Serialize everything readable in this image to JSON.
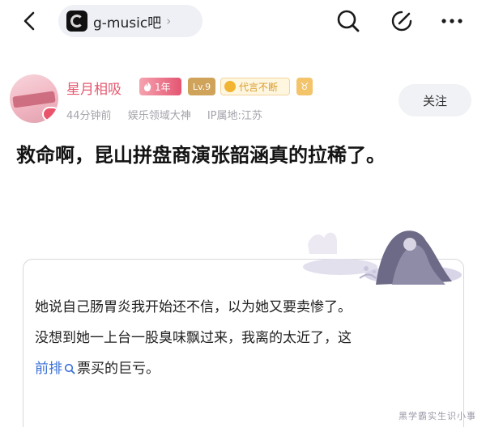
{
  "header": {
    "forum_name": "g-music吧",
    "chevron": "›",
    "icons": [
      "back-arrow-icon",
      "search-icon",
      "edit-icon",
      "more-icon"
    ]
  },
  "author": {
    "name": "星月相吸",
    "year_tag": "1年",
    "level_tag": "Lv.9",
    "generation_tag": "代言不断",
    "zodiac": "♉",
    "time": "44分钟前",
    "title_badge": "娱乐领域大神",
    "ip": "IP属地:江苏",
    "follow_label": "关注"
  },
  "post": {
    "title": "救命啊，昆山拼盘商演张韶涵真的拉稀了。",
    "quote_line1": "她说自己肠胃炎我开始还不信，以为她又要卖惨了。",
    "quote_line2": "没想到她一上台一股臭味飘过来，我离的太近了，这",
    "quote_link": "前排",
    "quote_line3_tail": "票买的巨亏。"
  },
  "watermark": "黑学霸实生识小事",
  "colors": {
    "username": "#e5586f",
    "link": "#3a6fd8",
    "chip_bg": "#eef0f6"
  }
}
